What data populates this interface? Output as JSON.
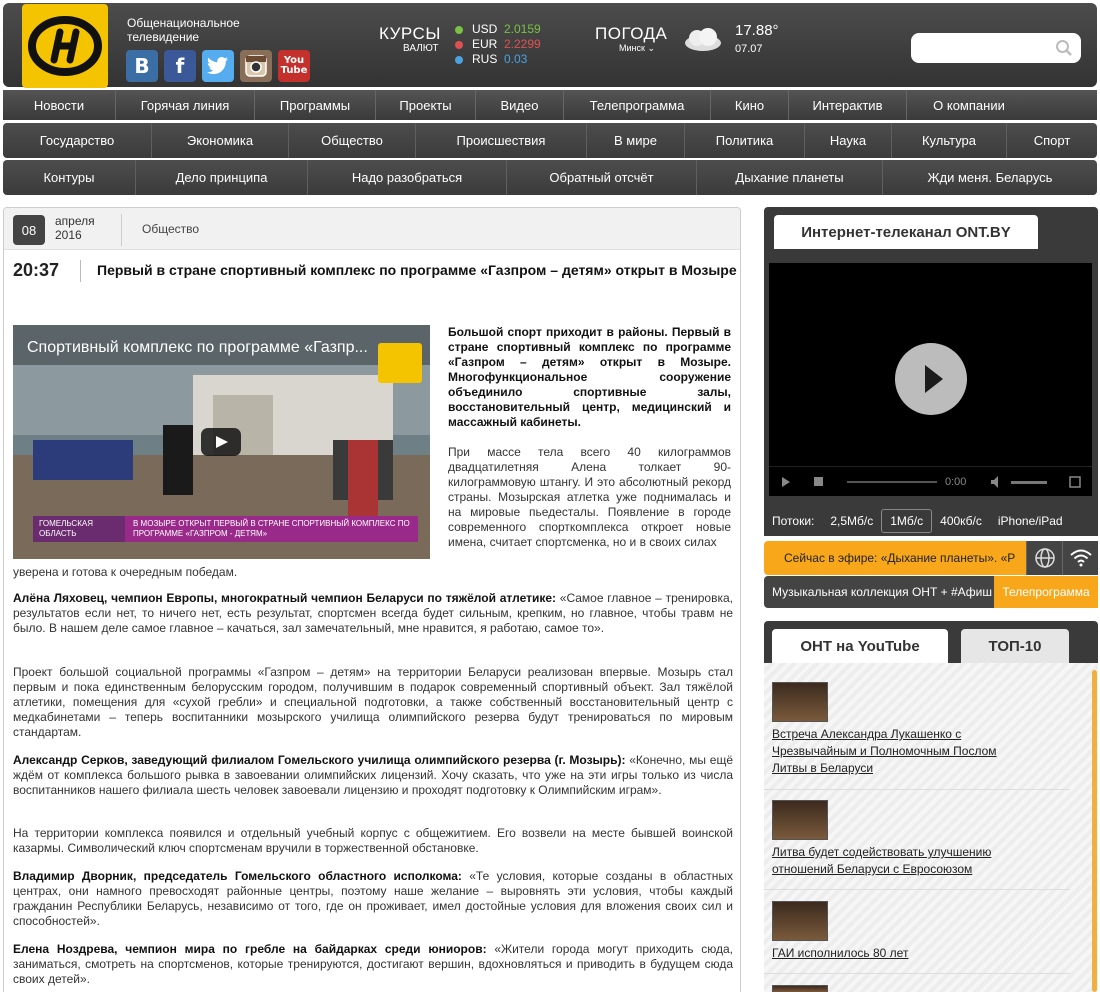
{
  "header": {
    "brand": "Общенациональное телевидение",
    "socials": [
      "В",
      "f",
      "t",
      "ig",
      "You Tube"
    ],
    "rates_title": "КУРСЫ",
    "rates_sub": "ВАЛЮТ",
    "rates": [
      {
        "cur": "USD",
        "val": "2.0159",
        "color": "#7bc143"
      },
      {
        "cur": "EUR",
        "val": "2.2299",
        "color": "#e05050"
      },
      {
        "cur": "RUS",
        "val": "0.03",
        "color": "#4aa3df"
      }
    ],
    "weather_title": "ПОГОДА",
    "weather_city": "Минск",
    "temp": "17.88°",
    "date": "07.07",
    "search_placeholder": ""
  },
  "nav_main": [
    "Новости",
    "Горячая линия",
    "Программы",
    "Проекты",
    "Видео",
    "Телепрограмма",
    "Кино",
    "Интерактив",
    "О компании"
  ],
  "nav_topics": [
    "Государство",
    "Экономика",
    "Общество",
    "Происшествия",
    "В мире",
    "Политика",
    "Наука",
    "Культура",
    "Спорт"
  ],
  "nav_shows": [
    "Контуры",
    "Дело принципа",
    "Надо разобраться",
    "Обратный отсчёт",
    "Дыхание планеты",
    "Жди меня. Беларусь"
  ],
  "article": {
    "day": "08",
    "month": "апреля",
    "year": "2016",
    "rubric": "Общество",
    "time": "20:37",
    "title": "Первый в стране спортивный комплекс по программе «Газпром – детям» открыт в Мозыре",
    "video_title": "Спортивный комплекс по программе «Газпр...",
    "caption_left": "ГОМЕЛЬСКАЯ ОБЛАСТЬ",
    "caption_right": "В МОЗЫРЕ ОТКРЫТ ПЕРВЫЙ В СТРАНЕ СПОРТИВНЫЙ КОМПЛЕКС ПО ПРОГРАММЕ «ГАЗПРОМ - ДЕТЯМ»",
    "lead": "Большой спорт приходит в районы. Первый в стране спортивный комплекс по программе «Газпром – детям» открыт в Мозыре. Многофункциональное сооружение объединило спортивные залы, восстановительный центр, медицинский и массажный кабинеты.",
    "p1": "При массе тела всего 40 килограммов двадцатилетняя Алена толкает 90-килограммовую штангу. И это абсолютный рекорд страны. Мозырская атлетка уже поднималась и на мировые пьедесталы. Появление в городе современного спорткомплекса откроет новые имена, считает спортсменка, но и в своих силах",
    "p1_cont": "уверена и готова к очередным победам.",
    "q1_name": "Алёна Ляховец, чемпион Европы, многократный чемпион Беларуси по тяжёлой атлетике:",
    "q1_text": " «Самое главное – тренировка, результатов если нет, то ничего нет, есть результат, спортсмен всегда будет сильным, крепким, но главное, чтобы травм не было. В нашем деле самое главное – качаться, зал замечательный, мне нравится, я работаю, самое то».",
    "p2": "Проект большой социальной программы «Газпром – детям» на территории Беларуси реализован впервые. Мозырь стал первым и пока единственным белорусским городом, получившим в подарок современный спортивный объект. Зал тяжёлой атлетики, помещения для «сухой гребли» и специальной подготовки, а также собственный восстановительный центр с медкабинетами – теперь воспитанники мозырского училища олимпийского резерва будут тренироваться по мировым стандартам.",
    "q2_name": "Александр Серков, заведующий филиалом Гомельского училища олимпийского резерва (г. Мозырь):",
    "q2_text": " «Конечно, мы ещё ждём от комплекса большого рывка в завоевании олимпийских лицензий. Хочу сказать, что уже на эти игры только из числа воспитанников нашего филиала шесть человек завоевали лицензию и проходят подготовку к Олимпийским играм».",
    "p3": "На территории комплекса появился и отдельный учебный корпус с общежитием. Его возвели на месте бывшей воинской казармы. Символический ключ спортсменам вручили в торжественной обстановке.",
    "q3_name": "Владимир Дворник, председатель Гомельского областного исполкома:",
    "q3_text": " «Те условия, которые созданы в областных центрах, они намного превосходят районные центры, поэтому наше желание – выровнять эти условия, чтобы каждый гражданин Республики Беларусь, независимо от того, где он проживает, имел достойные условия для вложения своих сил и способностей».",
    "q4_name": "Елена Ноздрева, чемпион мира по гребле на байдарках среди юниоров:",
    "q4_text": " «Жители города могут приходить сюда, заниматься, смотреть на спортсменов, которые тренируются, достигают вершин, вдохновляться и приводить в будущем сюда своих детей»."
  },
  "sidebar": {
    "tv_tab": "Интернет-телеканал ONT.BY",
    "player_time": "0:00",
    "streams_label": "Потоки:",
    "streams": [
      "2,5Мб/с",
      "1Мб/с",
      "400кб/с",
      "iPhone/iPad"
    ],
    "streams_active": 1,
    "onair": "Сейчас в эфире: «Дыхание планеты». «Р",
    "music": "Музыкальная коллекция ОНТ + #Афиш",
    "tvprog": "Телепрограмма",
    "yt_tab": "ОНТ на YouTube",
    "top_tab": "ТОП-10",
    "videos": [
      "Встреча Александра Лукашенко с Чрезвычайным и Полномочным Послом Литвы в Беларуси",
      "Литва будет содействовать улучшению отношений Беларуси с Евросоюзом",
      "ГАИ исполнилось 80 лет"
    ]
  }
}
